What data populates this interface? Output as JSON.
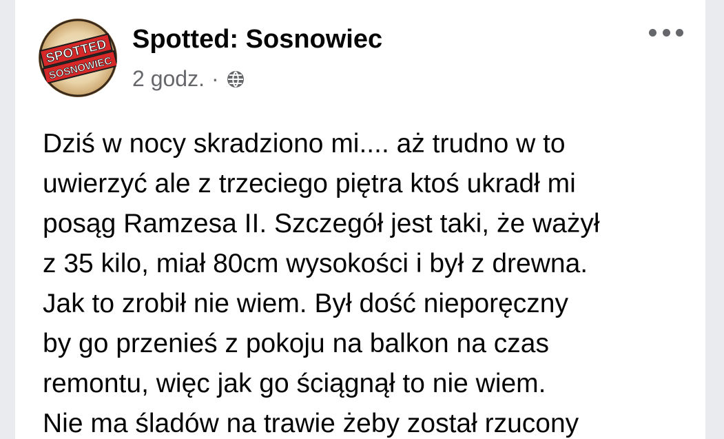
{
  "post": {
    "author": "Spotted: Sosnowiec",
    "avatar_text": [
      "SPOTTED",
      "SOSNOWIEC"
    ],
    "time": "2 godz.",
    "separator": "·",
    "audience_icon": "globe-icon",
    "more_icon": "more-options-icon",
    "body_lines": [
      "Dziś w nocy skradziono mi.... aż trudno w to",
      "uwierzyć ale z trzeciego piętra ktoś ukradł mi",
      "posąg Ramzesa II. Szczegół jest taki, że ważył",
      "z 35 kilo, miał 80cm wysokości i był z drewna.",
      "Jak to zrobił nie wiem. Był dość nieporęczny",
      "by go przenieś z pokoju na balkon na czas",
      "remontu, więc jak go ściągnął to nie wiem.",
      "Nie ma śladów na trawie żeby został rzucony"
    ]
  },
  "colors": {
    "background": "#e9ebee",
    "card": "#ffffff",
    "text_primary": "#050505",
    "text_secondary": "#65676b",
    "logo_red": "#d62828"
  }
}
